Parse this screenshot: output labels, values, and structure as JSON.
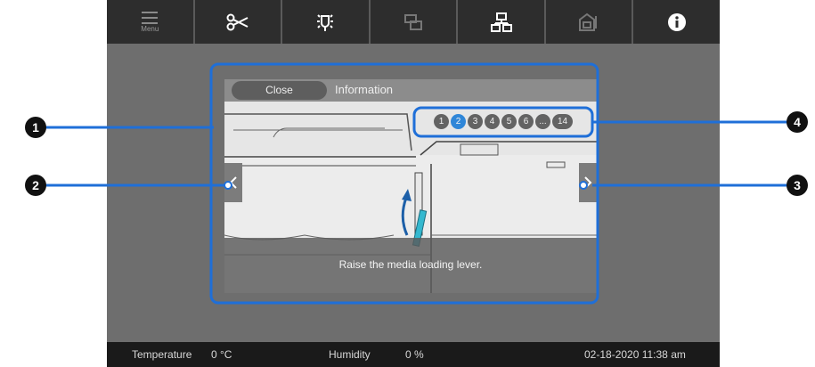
{
  "toolbar": {
    "menu_label": "Menu",
    "icons": [
      "menu-icon",
      "scissors-icon",
      "light-icon",
      "paper-settings-icon",
      "network-icon",
      "maintenance-icon",
      "info-icon"
    ]
  },
  "dialog": {
    "close_label": "Close",
    "title": "Information",
    "caption": "Raise the media loading lever.",
    "steps": [
      "1",
      "2",
      "3",
      "4",
      "5",
      "6",
      "...",
      "14"
    ],
    "active_step": "2"
  },
  "status": {
    "temperature_label": "Temperature",
    "temperature_value": "0 °C",
    "humidity_label": "Humidity",
    "humidity_value": "0 %",
    "datetime": "02-18-2020 11:38 am"
  },
  "callouts": [
    "1",
    "2",
    "3",
    "4"
  ],
  "colors": {
    "highlight": "#1f6fd8",
    "active_step": "#2f86d8",
    "panel": "#6e6e6e",
    "lever": "#34b8cf"
  }
}
